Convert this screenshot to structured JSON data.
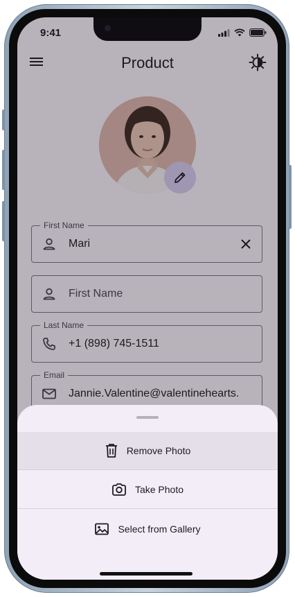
{
  "status_bar": {
    "time": "9:41"
  },
  "app_bar": {
    "title": "Product",
    "menu_icon": "menu-icon",
    "theme_icon": "brightness-icon"
  },
  "profile": {
    "avatar": "avatar-photo",
    "edit_icon": "pencil-icon"
  },
  "form": {
    "first_name": {
      "label": "First Name",
      "value": "Mari",
      "icon": "person-icon",
      "trailing_icon": "close-icon"
    },
    "first_name_empty": {
      "placeholder": "First Name",
      "icon": "person-icon"
    },
    "last_name": {
      "label": "Last Name",
      "value": "+1 (898) 745-1511",
      "icon": "phone-icon"
    },
    "email": {
      "label": "Email",
      "value": "Jannie.Valentine@valentinehearts.",
      "icon": "mail-icon"
    }
  },
  "sheet": {
    "items": [
      {
        "label": "Remove Photo",
        "icon": "trash-icon"
      },
      {
        "label": "Take Photo",
        "icon": "camera-icon"
      },
      {
        "label": "Select from Gallery",
        "icon": "image-icon"
      }
    ]
  },
  "colors": {
    "surface": "#fdf8fc",
    "sheet": "#f3edf7",
    "accent_container": "#d9cff0",
    "outline": "#79747e"
  }
}
